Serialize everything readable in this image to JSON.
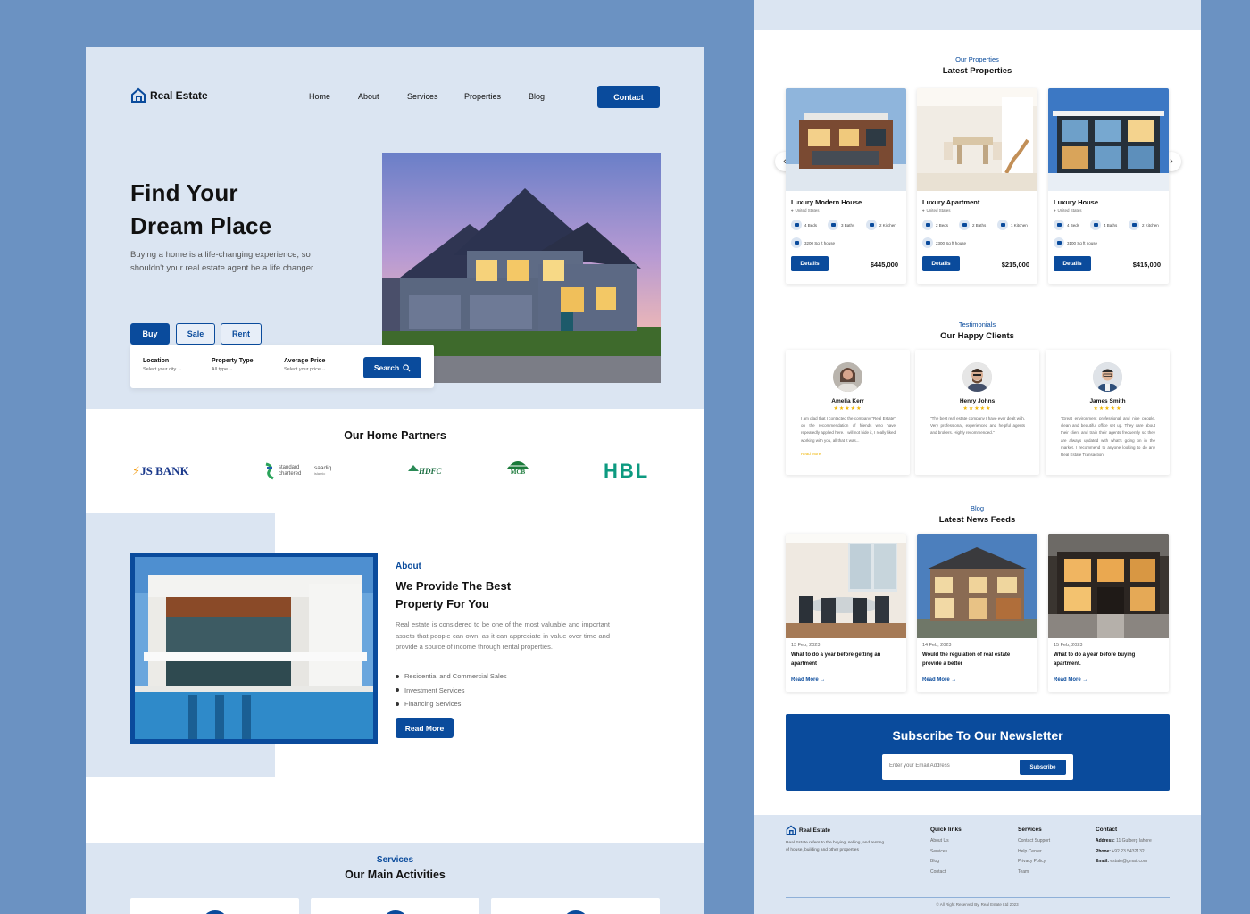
{
  "brand": "Real Estate",
  "nav": {
    "items": [
      "Home",
      "About",
      "Services",
      "Properties",
      "Blog"
    ],
    "contact": "Contact"
  },
  "hero": {
    "title_line1": "Find Your",
    "title_line2": "Dream Place",
    "subtitle": "Buying a home is a life-changing experience, so shouldn't your real estate agent be a life changer.",
    "tabs": [
      "Buy",
      "Sale",
      "Rent"
    ],
    "search": {
      "location_label": "Location",
      "location_value": "Select your city",
      "type_label": "Property Type",
      "type_value": "All type",
      "price_label": "Average Price",
      "price_value": "Select your price",
      "button": "Search"
    }
  },
  "partners": {
    "title": "Our Home Partners",
    "logos": [
      "JS BANK",
      "standard chartered",
      "saadiq",
      "islamic",
      "HDFC",
      "MCB",
      "HBL"
    ]
  },
  "about": {
    "kicker": "About",
    "title": "We Provide The Best Property For You",
    "text": "Real estate is considered to be one of the most valuable and important assets that people can own, as it can appreciate in value over time and provide a source of income through rental properties.",
    "list": [
      "Residential and Commercial Sales",
      "Investment Services",
      "Financing Services"
    ],
    "button": "Read More"
  },
  "services": {
    "kicker": "Services",
    "title": "Our Main Activities"
  },
  "properties": {
    "kicker": "Our Properties",
    "title": "Latest Properties",
    "items": [
      {
        "name": "Luxury Modern House",
        "location": "United States",
        "beds": "4 Beds",
        "baths": "3 Baths",
        "kitchen": "2 Kitchen",
        "area": "3200 Sq ft house",
        "button": "Details",
        "price": "$445,000"
      },
      {
        "name": "Luxury Apartment",
        "location": "United States",
        "beds": "2 Beds",
        "baths": "2 Baths",
        "kitchen": "1 Kitchen",
        "area": "2300 Sq ft house",
        "button": "Details",
        "price": "$215,000"
      },
      {
        "name": "Luxury House",
        "location": "United States",
        "beds": "4 Beds",
        "baths": "4 Baths",
        "kitchen": "2 Kitchen",
        "area": "3100 Sq ft house",
        "button": "Details",
        "price": "$415,000"
      }
    ]
  },
  "testimonials": {
    "kicker": "Testimonials",
    "title": "Our Happy Clients",
    "stars": "★★★★★",
    "items": [
      {
        "name": "Amelia Kerr",
        "text": "I am glad that I contacted the company \"Real Estate\" on the recommendation of friends who have repeatedly applied here. I will not hide it, I really liked working with you, all that it was...",
        "more": "Read More"
      },
      {
        "name": "Henry Johns",
        "text": "\"The best real estate company I have ever dealt with. Very professional, experienced and helpful agents and brokers. Highly recommended.\"",
        "more": ""
      },
      {
        "name": "James Smith",
        "text": "\"Great environment professional and nice people, clean and beautiful office set up. They care about their client and train their agents frequently so they are always updated with what's going on in the market. I recommend to anyone looking to do any Real Estate Transaction.",
        "more": ""
      }
    ]
  },
  "blog": {
    "kicker": "Blog",
    "title": "Latest News Feeds",
    "items": [
      {
        "date": "13 Feb, 2023",
        "title": "What to do a year before getting an apartment",
        "more": "Read More"
      },
      {
        "date": "14 Feb, 2023",
        "title": "Would the regulation of real estate provide a better",
        "more": "Read More"
      },
      {
        "date": "15 Feb, 2023",
        "title": "What to do a year before buying apartment.",
        "more": "Read More"
      }
    ]
  },
  "newsletter": {
    "title": "Subscribe To Our Newsletter",
    "placeholder": "Enter your Email Address",
    "button": "Subscribe"
  },
  "footer": {
    "brand": "Real Estate",
    "description": "Real Estate refers to the buying, selling, and renting of house, building and other properties",
    "quick_links": {
      "title": "Quick links",
      "items": [
        "About Us",
        "Services",
        "Blog",
        "Contact"
      ]
    },
    "services": {
      "title": "Services",
      "items": [
        "Contact Support",
        "Help Center",
        "Privacy Policy",
        "Team"
      ]
    },
    "contact": {
      "title": "Contact",
      "address_label": "Address:",
      "address": "11 Gulberg lahore",
      "phone_label": "Phone:",
      "phone": "+92 23 5432132",
      "email_label": "Email:",
      "email": "estate@gmail.com"
    },
    "copyright": "All Right Reserved By. Real Estate Ltd 2023"
  },
  "colors": {
    "primary": "#0a4b9c",
    "light": "#dbe5f2",
    "backdrop": "#6b92c2",
    "star": "#f0b400"
  }
}
